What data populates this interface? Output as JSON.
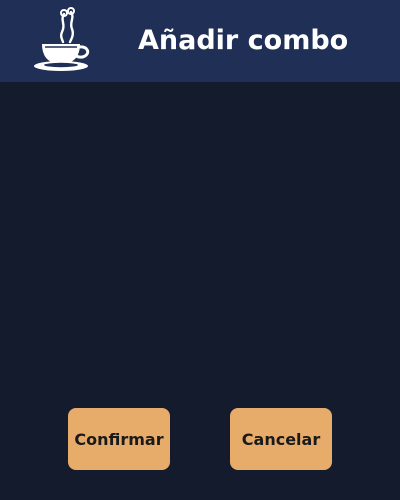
{
  "header": {
    "title": "Añadir combo",
    "logo_icon": "coffee-cup-icon"
  },
  "actions": {
    "confirm_label": "Confirmar",
    "cancel_label": "Cancelar"
  },
  "colors": {
    "header_bg": "#1f2f55",
    "content_bg": "#131b2d",
    "button_bg": "#e8ac6a",
    "button_text": "#1a1a1a",
    "title_text": "#ffffff"
  }
}
